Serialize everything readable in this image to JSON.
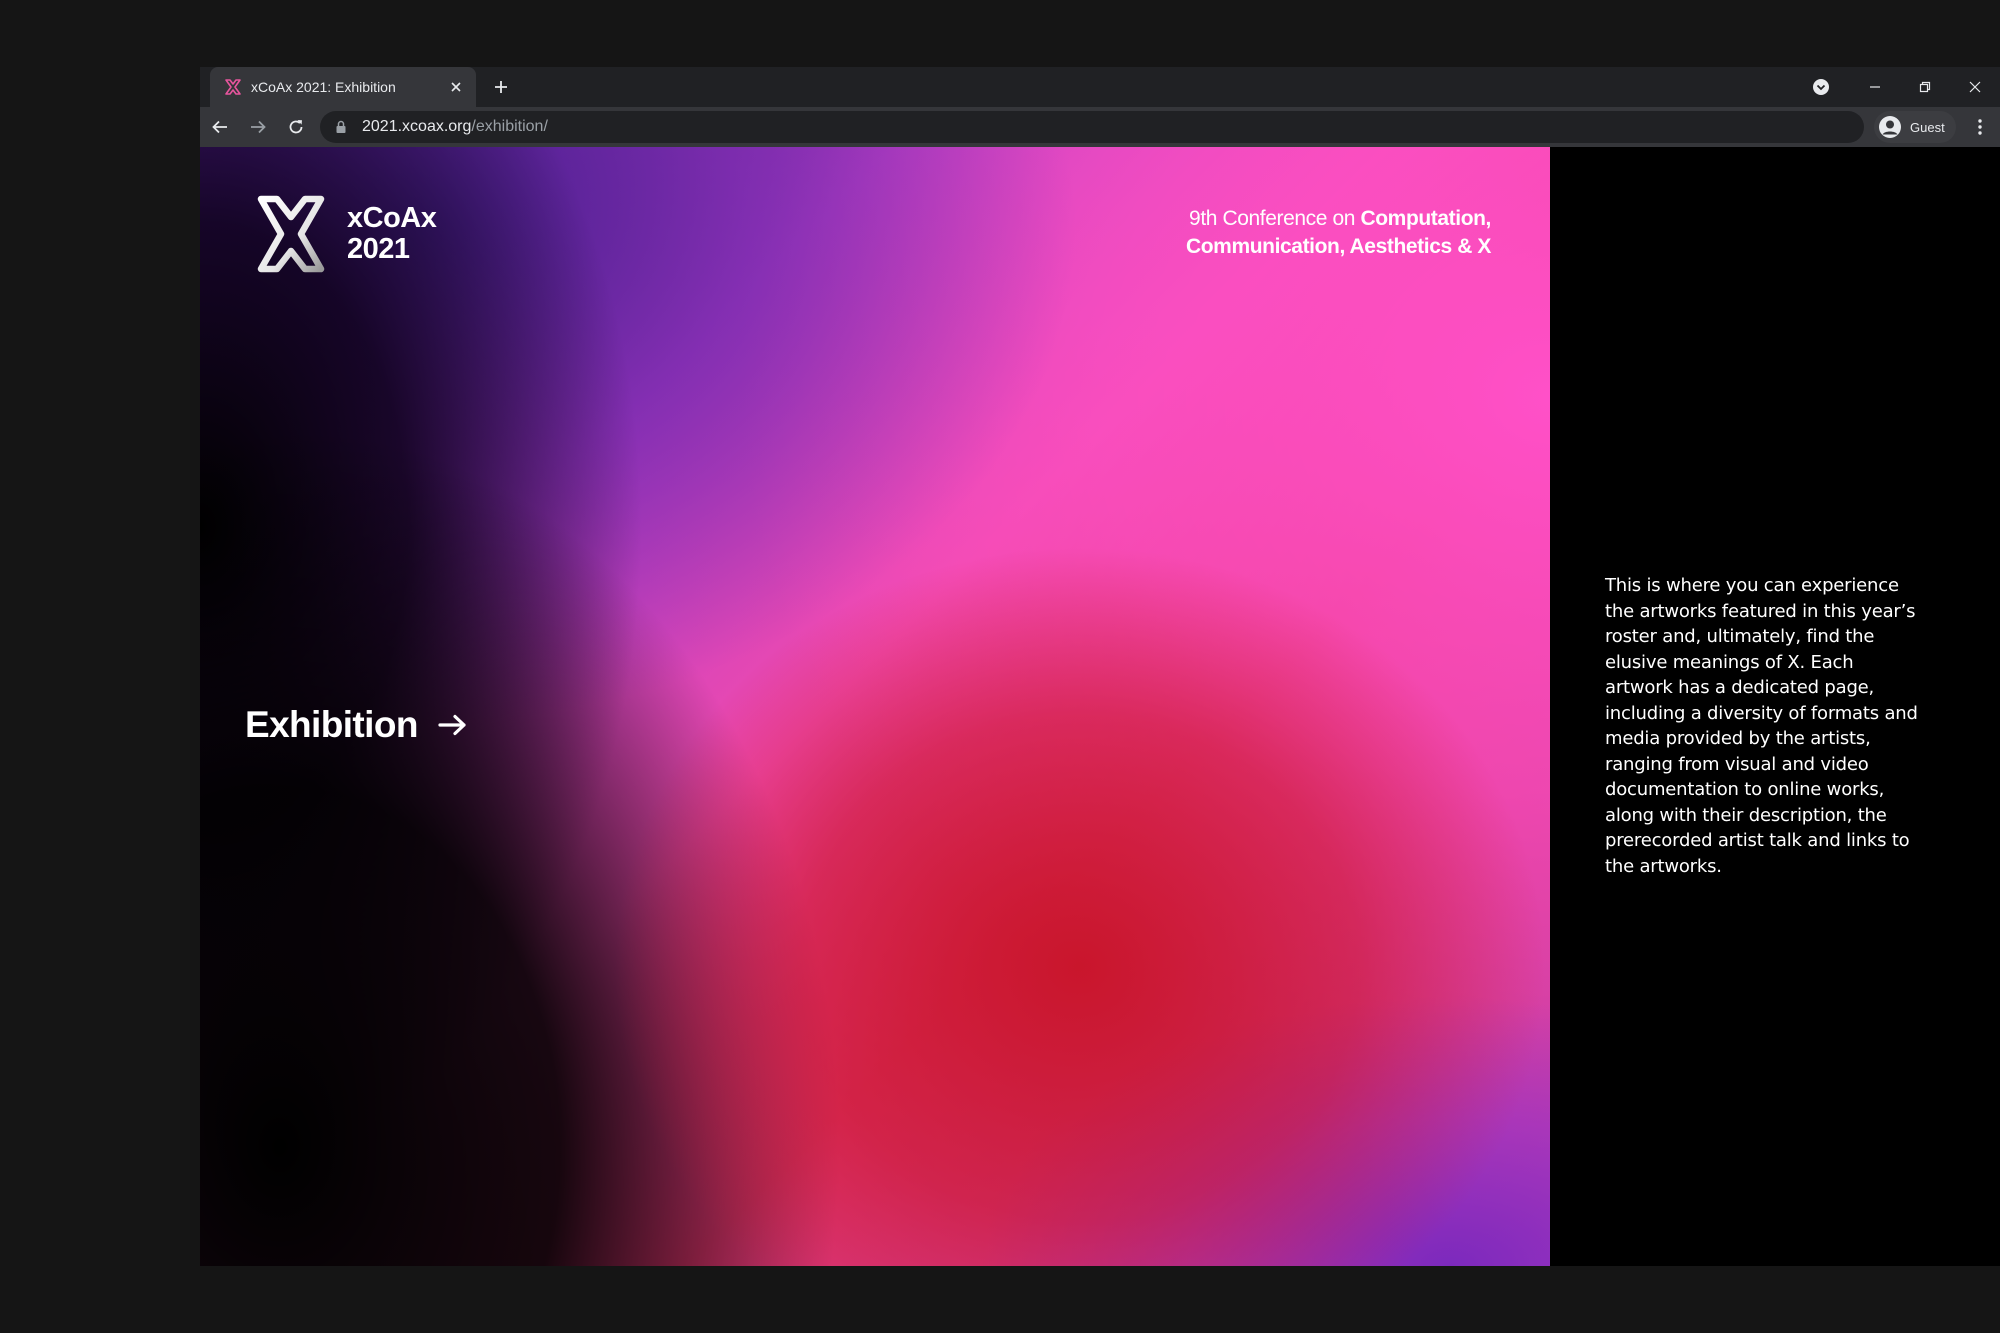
{
  "browser": {
    "tab": {
      "title": "xCoAx 2021: Exhibition",
      "favicon": "xcoax-x-icon"
    },
    "new_tab_label": "+",
    "address": {
      "host": "2021.xcoax.org",
      "path": "/exhibition/"
    },
    "profile": {
      "label": "Guest"
    },
    "icons": {
      "back": "arrow-left-icon",
      "forward": "arrow-right-icon",
      "reload": "reload-icon",
      "lock": "lock-icon",
      "menu": "kebab-menu-icon",
      "minimize": "minimize-icon",
      "restore": "restore-icon",
      "close": "close-icon",
      "tab_search": "tab-search-icon",
      "avatar": "user-avatar-icon"
    },
    "colors": {
      "tabstrip": "#202124",
      "toolbar": "#35363a",
      "omnibox": "#202124",
      "text": "#e8eaed",
      "muted": "#9aa0a6"
    }
  },
  "page": {
    "logo": {
      "line1": "xCoAx",
      "line2": "2021"
    },
    "tagline": {
      "prefix": "9th Conference on ",
      "strong": "Computation, Communication, Aesthetics & X"
    },
    "cta": {
      "label": "Exhibition",
      "icon": "arrow-right-icon"
    },
    "description": "This is where you can experience the artworks featured in this year’s roster and, ultimately, find the elusive meanings of X. Each artwork has a dedicated page, including a diversity of formats and media provided by the artists, ranging from visual and video documentation to online works, along with their description, the prerecorded artist talk and links to the artworks.",
    "colors": {
      "accent_pink": "#ff4bc3",
      "accent_purple": "#8a35c4",
      "accent_red": "#c8142a",
      "sidebar_bg": "#000000",
      "text": "#ffffff"
    }
  }
}
